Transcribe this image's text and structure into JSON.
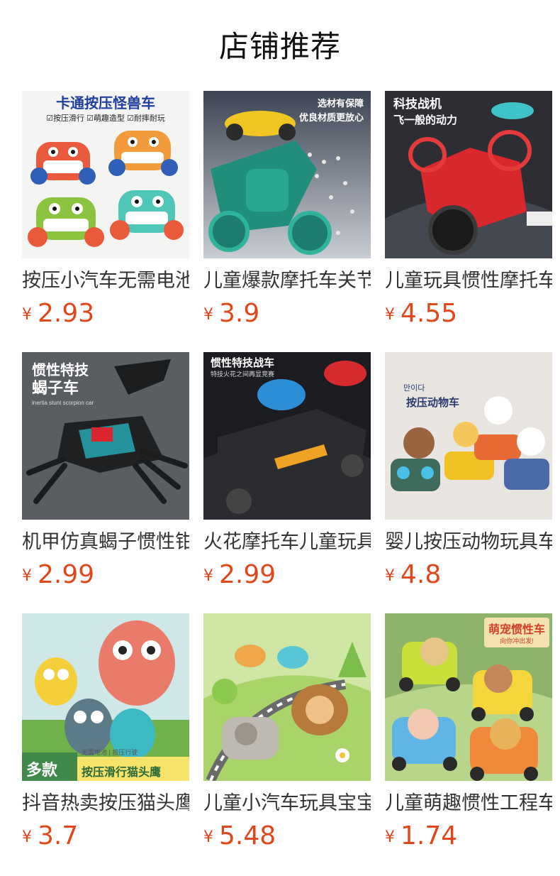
{
  "section": {
    "title": "店铺推荐"
  },
  "currency_symbol": "¥",
  "products": [
    {
      "name": "按压小汽车无需电池惯性车",
      "price": "2.93",
      "banner": "卡通按压怪兽车",
      "tags": "☑按压滑行 ☑萌趣造型 ☑耐摔耐玩"
    },
    {
      "name": "儿童爆款摩托车关节可动",
      "price": "3.9",
      "banner": "选材有保障",
      "banner2": "优良材质更放心"
    },
    {
      "name": "儿童玩具惯性摩托车特技",
      "price": "4.55",
      "banner": "科技战机",
      "banner2": "飞一般的动力"
    },
    {
      "name": "机甲仿真蝎子惯性钳子车",
      "price": "2.99",
      "banner": "惯性特技",
      "banner2": "蝎子车",
      "banner3": "inertia stunt scorpion car"
    },
    {
      "name": "火花摩托车儿童玩具惯性",
      "price": "2.99",
      "banner": "惯性特技战车",
      "banner2": "特技火花之间再显竞赛"
    },
    {
      "name": "婴儿按压动物玩具车可爱",
      "price": "4.8",
      "banner": "按压动物车",
      "banner2": "만이다"
    },
    {
      "name": "抖音热卖按压猫头鹰玩具",
      "price": "3.7",
      "banner": "多款",
      "banner2": "按压滑行猫头鹰",
      "banner3": "无需电池 | 按压行驶"
    },
    {
      "name": "儿童小汽车玩具宝宝惯性",
      "price": "5.48"
    },
    {
      "name": "儿童萌趣惯性工程车套装",
      "price": "1.74",
      "banner": "萌宠惯性车",
      "banner2": "向你冲出发!"
    }
  ]
}
